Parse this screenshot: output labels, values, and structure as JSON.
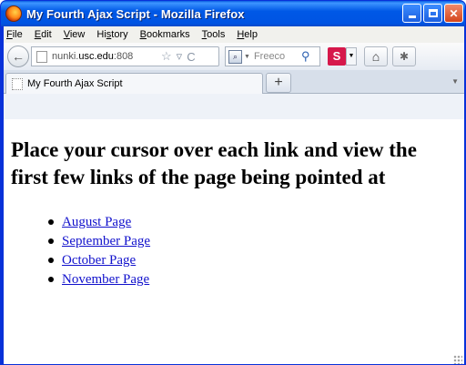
{
  "window": {
    "title": "My Fourth Ajax Script - Mozilla Firefox"
  },
  "menubar": {
    "items": [
      {
        "label": "File",
        "accel": "F"
      },
      {
        "label": "Edit",
        "accel": "E"
      },
      {
        "label": "View",
        "accel": "V"
      },
      {
        "label": "History",
        "accel": "s"
      },
      {
        "label": "Bookmarks",
        "accel": "B"
      },
      {
        "label": "Tools",
        "accel": "T"
      },
      {
        "label": "Help",
        "accel": "H"
      }
    ]
  },
  "navbar": {
    "url_domain": "nunki.",
    "url_host": "usc.edu",
    "url_rest": ":808",
    "search_placeholder": "Freeco",
    "search_engine_icon": "search-engine-icon",
    "addon_label": "S"
  },
  "tabs": [
    {
      "label": "My Fourth Ajax Script"
    }
  ],
  "content": {
    "heading": "Place your cursor over each link and view the first few links of the page being pointed at",
    "links": [
      {
        "label": "August Page"
      },
      {
        "label": "September Page"
      },
      {
        "label": "October Page"
      },
      {
        "label": "November Page"
      }
    ]
  },
  "colors": {
    "titlebar": "#0054e3",
    "link": "#1111cc",
    "close_button": "#d4451c"
  }
}
